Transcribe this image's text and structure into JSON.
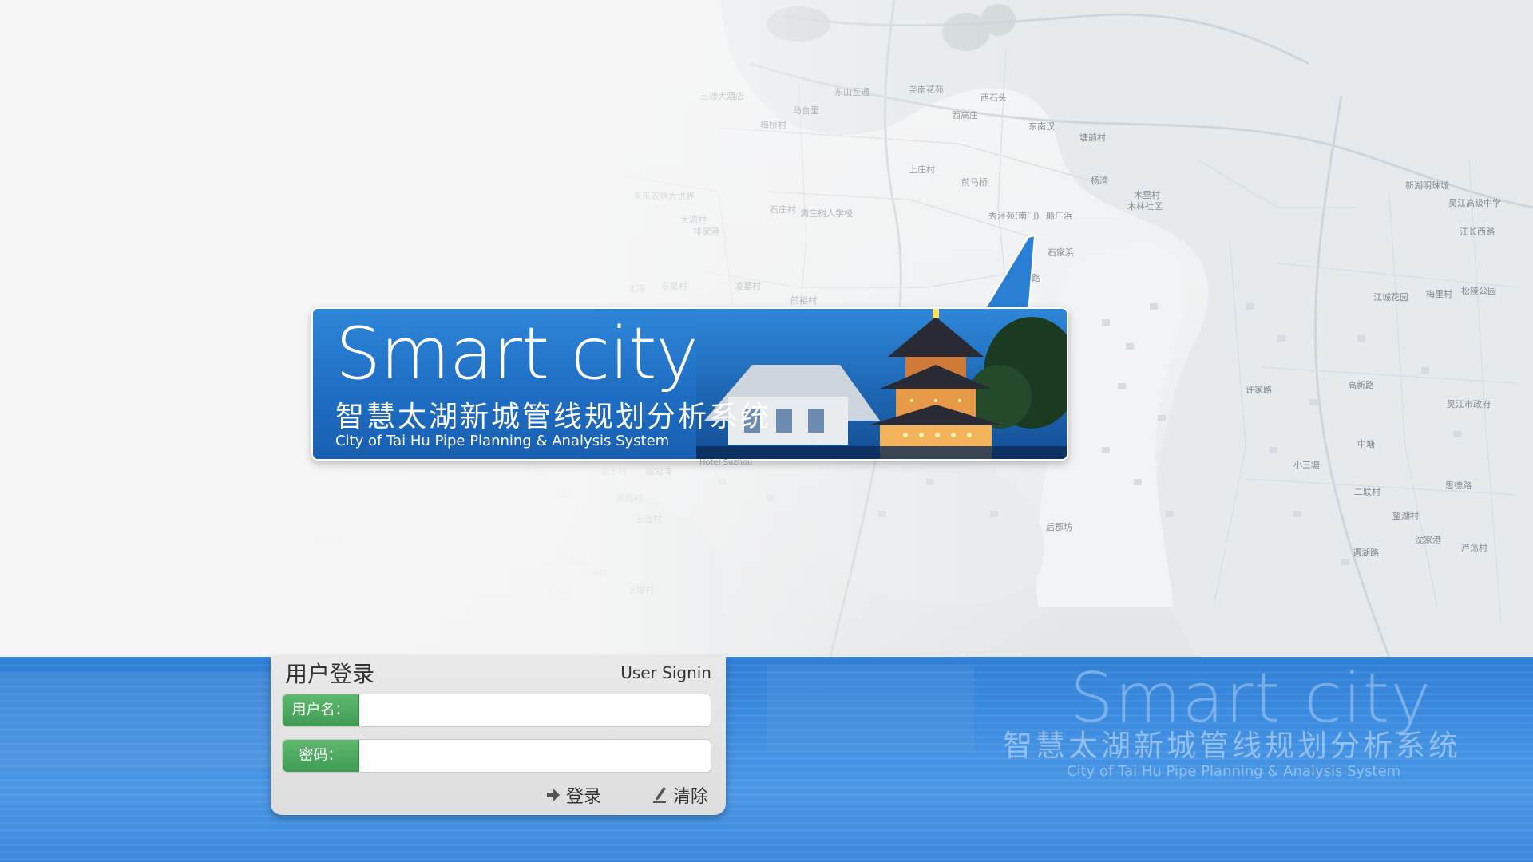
{
  "banner": {
    "title": "Smart city",
    "subtitle_cn": "智慧太湖新城管线规划分析系统",
    "subtitle_en": "City of Tai Hu Pipe Planning & Analysis System",
    "photo_caption": "Hotel Suzhou"
  },
  "watermark": {
    "title": "Smart city",
    "subtitle_cn": "智慧太湖新城管线规划分析系统",
    "subtitle_en": "City of Tai Hu Pipe Planning & Analysis System"
  },
  "login": {
    "title": "用户登录",
    "title_en": "User Signin",
    "username_label": "用户名：",
    "username_value": "",
    "password_label": "密码：",
    "password_value": "",
    "login_button": "登录",
    "clear_button": "清除",
    "login_icon": "arrow-right-icon",
    "clear_icon": "pen-icon"
  },
  "map_labels": [
    "三德大酒店",
    "马舍里",
    "梅桥村",
    "东山互通",
    "尧南花苑",
    "西石头",
    "西高庄",
    "东南汉",
    "塘前村",
    "未来农林大世界",
    "大塘村",
    "排家港",
    "石庄村",
    "满庄树人学校",
    "上庄村",
    "前马桥",
    "秀泾苑(南门)",
    "船厂浜",
    "杨湾",
    "木里村",
    "木林社区",
    "石家浜",
    "西斜路",
    "北港",
    "东吴村",
    "凌墓村",
    "前裕村",
    "黄墅村",
    "金上村",
    "临湖湾",
    "火烧浜",
    "前陆村",
    "三连村",
    "白马涧",
    "北西墩",
    "南西墩",
    "前陆村",
    "三塘村",
    "新湖明珠城",
    "吴江高级中学",
    "江长西路",
    "松陵公园",
    "江城花园",
    "梅里村",
    "高新路",
    "吴江市政府",
    "中塘",
    "二联村",
    "小三塘",
    "望湖村",
    "思德路",
    "遇湖路",
    "沈家港",
    "芦荡村",
    "许家路",
    "后郡坊"
  ],
  "colors": {
    "banner_blue": "#1f6ec4",
    "band_blue": "#3b8be0",
    "label_green": "#3f9a55",
    "panel_gray": "#e5e5e5"
  }
}
